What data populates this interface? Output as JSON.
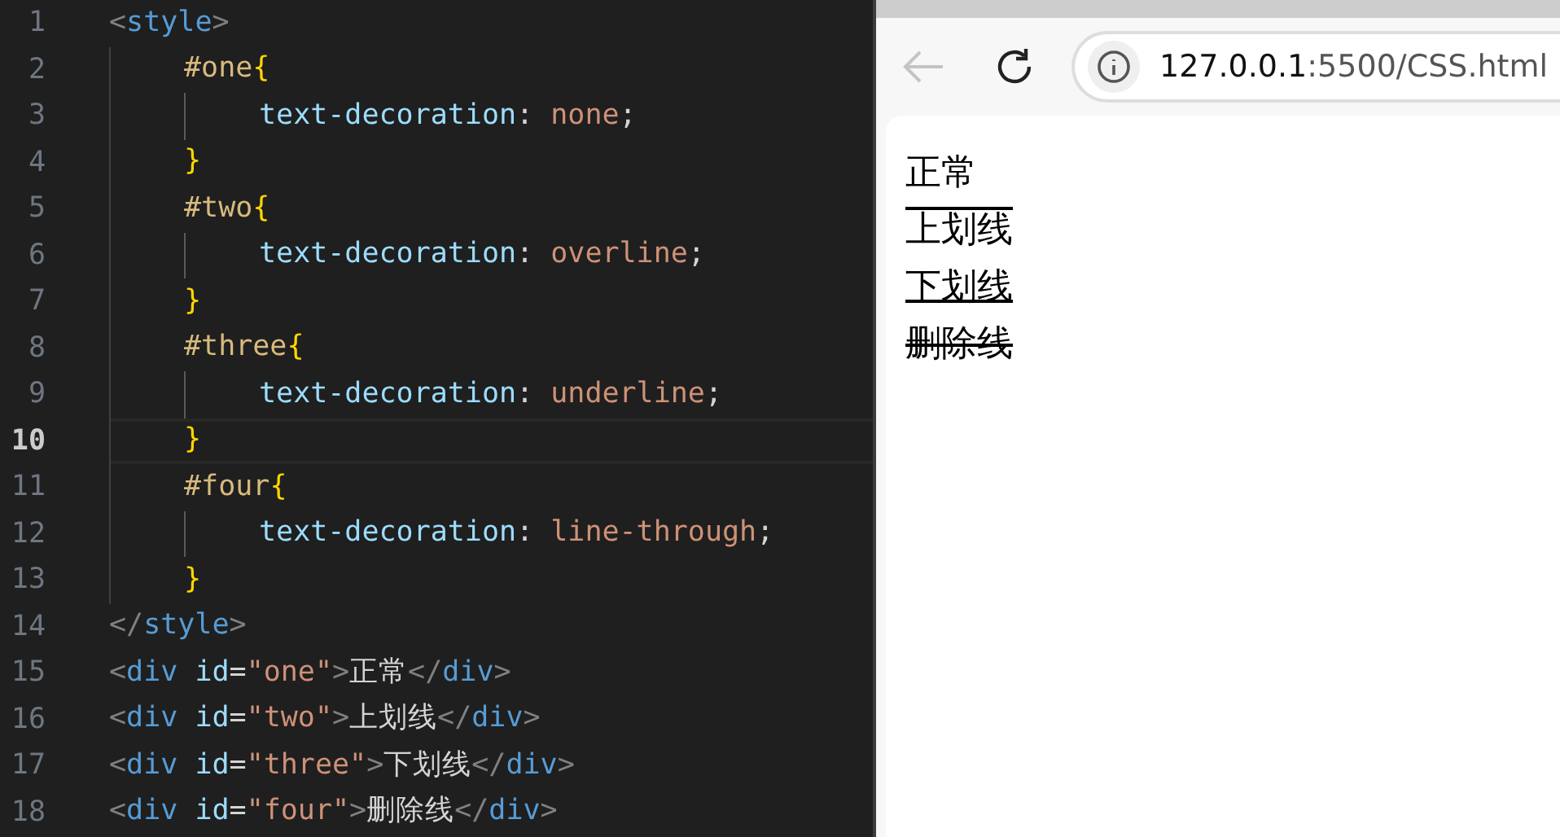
{
  "editor": {
    "lines": [
      {
        "number": "1",
        "current": false,
        "tokens": [
          {
            "kind": "punct",
            "text": "<"
          },
          {
            "kind": "tag",
            "text": "style"
          },
          {
            "kind": "punct",
            "text": ">"
          }
        ],
        "children": [
          {
            "number": "2",
            "current": false,
            "tokens": [
              {
                "kind": "selector",
                "text": "#one"
              },
              {
                "kind": "brace",
                "text": "{"
              }
            ],
            "children": [
              {
                "number": "3",
                "current": false,
                "tokens": [
                  {
                    "kind": "property",
                    "text": "text-decoration"
                  },
                  {
                    "kind": "plain",
                    "text": ": "
                  },
                  {
                    "kind": "value",
                    "text": "none"
                  },
                  {
                    "kind": "plain",
                    "text": ";"
                  }
                ]
              }
            ]
          },
          {
            "number": "4",
            "current": false,
            "tokens": [
              {
                "kind": "brace",
                "text": "}"
              }
            ]
          },
          {
            "number": "5",
            "current": false,
            "tokens": [
              {
                "kind": "selector",
                "text": "#two"
              },
              {
                "kind": "brace",
                "text": "{"
              }
            ],
            "children": [
              {
                "number": "6",
                "current": false,
                "tokens": [
                  {
                    "kind": "property",
                    "text": "text-decoration"
                  },
                  {
                    "kind": "plain",
                    "text": ": "
                  },
                  {
                    "kind": "value",
                    "text": "overline"
                  },
                  {
                    "kind": "plain",
                    "text": ";"
                  }
                ]
              }
            ]
          },
          {
            "number": "7",
            "current": false,
            "tokens": [
              {
                "kind": "brace",
                "text": "}"
              }
            ]
          },
          {
            "number": "8",
            "current": false,
            "tokens": [
              {
                "kind": "selector",
                "text": "#three"
              },
              {
                "kind": "brace",
                "text": "{"
              }
            ],
            "children": [
              {
                "number": "9",
                "current": false,
                "tokens": [
                  {
                    "kind": "property",
                    "text": "text-decoration"
                  },
                  {
                    "kind": "plain",
                    "text": ": "
                  },
                  {
                    "kind": "value",
                    "text": "underline"
                  },
                  {
                    "kind": "plain",
                    "text": ";"
                  }
                ]
              }
            ]
          },
          {
            "number": "10",
            "current": true,
            "tokens": [
              {
                "kind": "brace",
                "text": "}"
              }
            ]
          },
          {
            "number": "11",
            "current": false,
            "tokens": [
              {
                "kind": "selector",
                "text": "#four"
              },
              {
                "kind": "brace",
                "text": "{"
              }
            ],
            "children": [
              {
                "number": "12",
                "current": false,
                "tokens": [
                  {
                    "kind": "property",
                    "text": "text-decoration"
                  },
                  {
                    "kind": "plain",
                    "text": ": "
                  },
                  {
                    "kind": "value",
                    "text": "line-through"
                  },
                  {
                    "kind": "plain",
                    "text": ";"
                  }
                ]
              }
            ]
          },
          {
            "number": "13",
            "current": false,
            "tokens": [
              {
                "kind": "brace",
                "text": "}"
              }
            ]
          }
        ]
      },
      {
        "number": "14",
        "current": false,
        "tokens": [
          {
            "kind": "punct",
            "text": "</"
          },
          {
            "kind": "tag",
            "text": "style"
          },
          {
            "kind": "punct",
            "text": ">"
          }
        ]
      },
      {
        "number": "15",
        "current": false,
        "tokens": [
          {
            "kind": "punct",
            "text": "<"
          },
          {
            "kind": "tag",
            "text": "div"
          },
          {
            "kind": "attr",
            "text": " id"
          },
          {
            "kind": "plain",
            "text": "="
          },
          {
            "kind": "string",
            "text": "\"one\""
          },
          {
            "kind": "punct",
            "text": ">"
          },
          {
            "kind": "plain",
            "text": "正常"
          },
          {
            "kind": "punct",
            "text": "</"
          },
          {
            "kind": "tag",
            "text": "div"
          },
          {
            "kind": "punct",
            "text": ">"
          }
        ]
      },
      {
        "number": "16",
        "current": false,
        "tokens": [
          {
            "kind": "punct",
            "text": "<"
          },
          {
            "kind": "tag",
            "text": "div"
          },
          {
            "kind": "attr",
            "text": " id"
          },
          {
            "kind": "plain",
            "text": "="
          },
          {
            "kind": "string",
            "text": "\"two\""
          },
          {
            "kind": "punct",
            "text": ">"
          },
          {
            "kind": "plain",
            "text": "上划线"
          },
          {
            "kind": "punct",
            "text": "</"
          },
          {
            "kind": "tag",
            "text": "div"
          },
          {
            "kind": "punct",
            "text": ">"
          }
        ]
      },
      {
        "number": "17",
        "current": false,
        "tokens": [
          {
            "kind": "punct",
            "text": "<"
          },
          {
            "kind": "tag",
            "text": "div"
          },
          {
            "kind": "attr",
            "text": " id"
          },
          {
            "kind": "plain",
            "text": "="
          },
          {
            "kind": "string",
            "text": "\"three\""
          },
          {
            "kind": "punct",
            "text": ">"
          },
          {
            "kind": "plain",
            "text": "下划线"
          },
          {
            "kind": "punct",
            "text": "</"
          },
          {
            "kind": "tag",
            "text": "div"
          },
          {
            "kind": "punct",
            "text": ">"
          }
        ]
      },
      {
        "number": "18",
        "current": false,
        "tokens": [
          {
            "kind": "punct",
            "text": "<"
          },
          {
            "kind": "tag",
            "text": "div"
          },
          {
            "kind": "attr",
            "text": " id"
          },
          {
            "kind": "plain",
            "text": "="
          },
          {
            "kind": "string",
            "text": "\"four\""
          },
          {
            "kind": "punct",
            "text": ">"
          },
          {
            "kind": "plain",
            "text": "删除线"
          },
          {
            "kind": "punct",
            "text": "</"
          },
          {
            "kind": "tag",
            "text": "div"
          },
          {
            "kind": "punct",
            "text": ">"
          }
        ]
      }
    ]
  },
  "browser": {
    "back_disabled": true,
    "address": {
      "host": "127.0.0.1",
      "path": ":5500/CSS.html"
    },
    "page": [
      {
        "text": "正常",
        "kind": "plain"
      },
      {
        "text": "上划线",
        "kind": "overline"
      },
      {
        "text": "下划线",
        "kind": "underline"
      },
      {
        "text": "删除线",
        "kind": "strike"
      }
    ]
  }
}
